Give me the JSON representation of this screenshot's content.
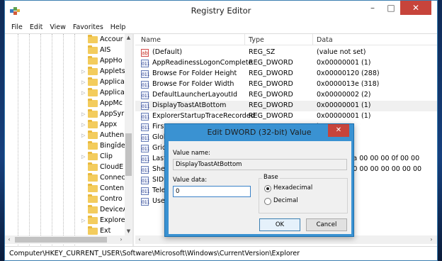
{
  "window": {
    "title": "Registry Editor",
    "controls": {
      "minimize": "–",
      "maximize": "□",
      "close": "✕"
    }
  },
  "menu": [
    "File",
    "Edit",
    "View",
    "Favorites",
    "Help"
  ],
  "tree": {
    "items": [
      {
        "label": "Accour",
        "expander": ""
      },
      {
        "label": "AIS",
        "expander": ""
      },
      {
        "label": "AppHo",
        "expander": ""
      },
      {
        "label": "Applets",
        "expander": "▷"
      },
      {
        "label": "Applica",
        "expander": "▷"
      },
      {
        "label": "Applica",
        "expander": "▷"
      },
      {
        "label": "AppMc",
        "expander": ""
      },
      {
        "label": "AppSyr",
        "expander": "▷"
      },
      {
        "label": "Appx",
        "expander": "▷"
      },
      {
        "label": "Authen",
        "expander": "▷"
      },
      {
        "label": "Bingīde",
        "expander": ""
      },
      {
        "label": "Clip",
        "expander": "▷"
      },
      {
        "label": "CloudE",
        "expander": ""
      },
      {
        "label": "Conneci",
        "expander": ""
      },
      {
        "label": "Conten",
        "expander": ""
      },
      {
        "label": "Contro",
        "expander": ""
      },
      {
        "label": "DeviceA",
        "expander": ""
      },
      {
        "label": "Explore",
        "expander": "▷"
      },
      {
        "label": "Ext",
        "expander": ""
      }
    ]
  },
  "values": {
    "headers": {
      "name": "Name",
      "type": "Type",
      "data": "Data"
    },
    "rows": [
      {
        "icon": "ab",
        "name": "(Default)",
        "type": "REG_SZ",
        "data": "(value not set)"
      },
      {
        "icon": "011",
        "name": "AppReadinessLogonComplete",
        "type": "REG_DWORD",
        "data": "0x00000001 (1)"
      },
      {
        "icon": "011",
        "name": "Browse For Folder Height",
        "type": "REG_DWORD",
        "data": "0x00000120 (288)"
      },
      {
        "icon": "011",
        "name": "Browse For Folder Width",
        "type": "REG_DWORD",
        "data": "0x0000013e (318)"
      },
      {
        "icon": "011",
        "name": "DefaultLauncherLayoutId",
        "type": "REG_DWORD",
        "data": "0x00000002 (2)"
      },
      {
        "icon": "011",
        "name": "DisplayToastAtBottom",
        "type": "REG_DWORD",
        "data": "0x00000001 (1)"
      },
      {
        "icon": "011",
        "name": "ExplorerStartupTraceRecorded",
        "type": "REG_DWORD",
        "data": "0x00000001 (1)"
      },
      {
        "icon": "011",
        "name": "FirstR",
        "type": "",
        "data": ")"
      },
      {
        "icon": "011",
        "name": "Globa",
        "type": "",
        "data": ")"
      },
      {
        "icon": "011",
        "name": "GridP",
        "type": "",
        "data": ")"
      },
      {
        "icon": "011",
        "name": "LastC",
        "type": "",
        "data": "00 00 00 3a 00 00 00 0f 00 00"
      },
      {
        "icon": "011",
        "name": "ShellS",
        "type": "",
        "data": "28 00 00 00 00 00 00 00 00 00"
      },
      {
        "icon": "011",
        "name": "SIDUp",
        "type": "",
        "data": ")"
      },
      {
        "icon": "011",
        "name": "Telem",
        "type": "",
        "data": ")"
      },
      {
        "icon": "011",
        "name": "UserS",
        "type": "",
        "data": ")"
      }
    ]
  },
  "status": "Computer\\HKEY_CURRENT_USER\\Software\\Microsoft\\Windows\\CurrentVersion\\Explorer",
  "dialog": {
    "title": "Edit DWORD (32-bit) Value",
    "close": "✕",
    "value_name_label": "Value name:",
    "value_name": "DisplayToastAtBottom",
    "value_data_label": "Value data:",
    "value_data": "0",
    "base_label": "Base",
    "hex_label": "Hexadecimal",
    "dec_label": "Decimal",
    "ok": "OK",
    "cancel": "Cancel"
  }
}
